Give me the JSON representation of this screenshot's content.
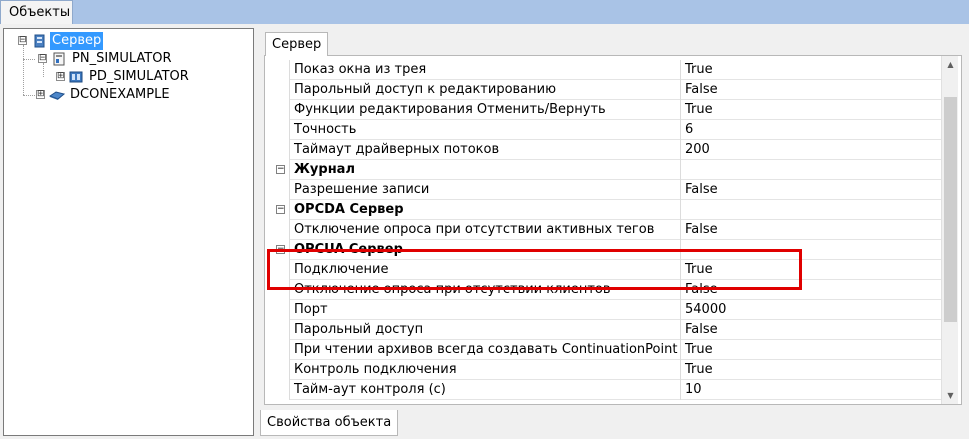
{
  "top_tab": {
    "label": "Объекты"
  },
  "tree": {
    "items": [
      {
        "label": "Сервер",
        "expander": "⊟",
        "icon": "server-icon",
        "selected": true
      },
      {
        "label": "PN_SIMULATOR",
        "expander": "⊟",
        "icon": "network-node-icon"
      },
      {
        "label": "PD_SIMULATOR",
        "expander": "⊞",
        "icon": "device-icon"
      },
      {
        "label": "DCONEXAMPLE",
        "expander": "⊞",
        "icon": "dcon-icon"
      }
    ]
  },
  "inner_tab": {
    "label": "Сервер"
  },
  "grid": {
    "rows": [
      {
        "name": "Показ окна из трея",
        "value": "True",
        "category": false
      },
      {
        "name": "Парольный доступ к редактированию",
        "value": "False",
        "category": false
      },
      {
        "name": "Функции редактирования Отменить/Вернуть",
        "value": "True",
        "category": false
      },
      {
        "name": "Точность",
        "value": "6",
        "category": false
      },
      {
        "name": "Таймаут драйверных потоков",
        "value": "200",
        "category": false
      },
      {
        "name": "Журнал",
        "value": "",
        "category": true,
        "toggle": "−"
      },
      {
        "name": "Разрешение записи",
        "value": "False",
        "category": false
      },
      {
        "name": "OPCDA Сервер",
        "value": "",
        "category": true,
        "toggle": "−"
      },
      {
        "name": "Отключение опроса при отсутствии активных тегов",
        "value": "False",
        "category": false
      },
      {
        "name": "OPCUA Сервер",
        "value": "",
        "category": true,
        "toggle": "−"
      },
      {
        "name": "Подключение",
        "value": "True",
        "category": false
      },
      {
        "name": "Отключение опроса при отсутствии клиентов",
        "value": "False",
        "category": false
      },
      {
        "name": "Порт",
        "value": "54000",
        "category": false
      },
      {
        "name": "Парольный доступ",
        "value": "False",
        "category": false
      },
      {
        "name": "При чтении архивов всегда создавать ContinuationPoint",
        "value": "True",
        "category": false
      },
      {
        "name": "Контроль подключения",
        "value": "True",
        "category": false
      },
      {
        "name": "Тайм-аут контроля (с)",
        "value": "10",
        "category": false
      }
    ],
    "scroll_up_glyph": "▲",
    "scroll_down_glyph": "▼"
  },
  "bottom_tab": {
    "label": "Свойства объекта"
  },
  "colors": {
    "selection": "#3399ff",
    "highlight": "#e00000",
    "topbar": "#a9c3e6"
  }
}
